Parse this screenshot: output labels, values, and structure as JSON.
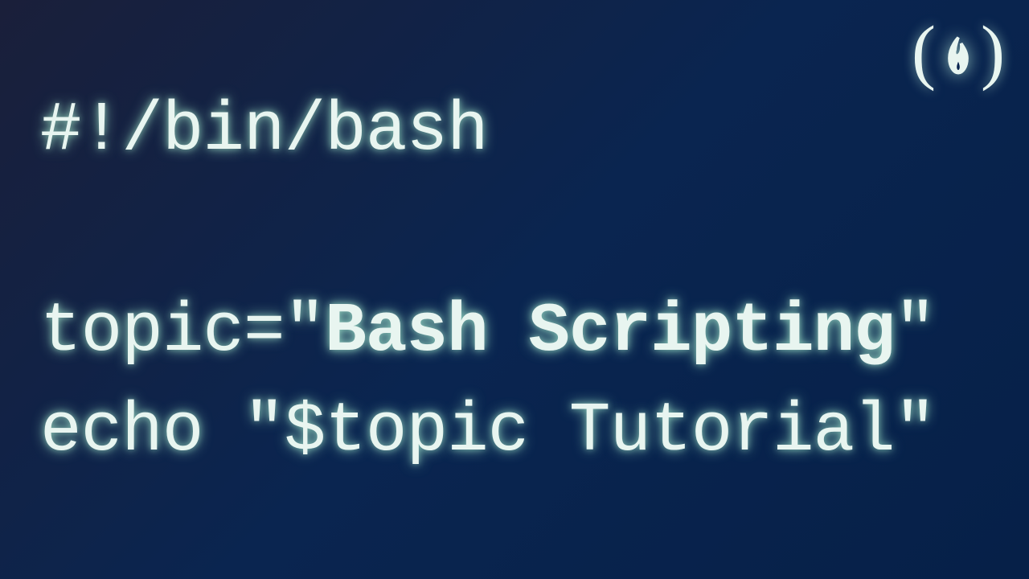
{
  "logo": {
    "left_paren": "(",
    "right_paren": ")",
    "icon_name": "flame-icon"
  },
  "code": {
    "line1": "#!/bin/bash",
    "line2_prefix": "topic=\"",
    "line2_bold": "Bash Scripting",
    "line2_suffix": "\"",
    "line3": "echo \"$topic Tutorial\""
  }
}
